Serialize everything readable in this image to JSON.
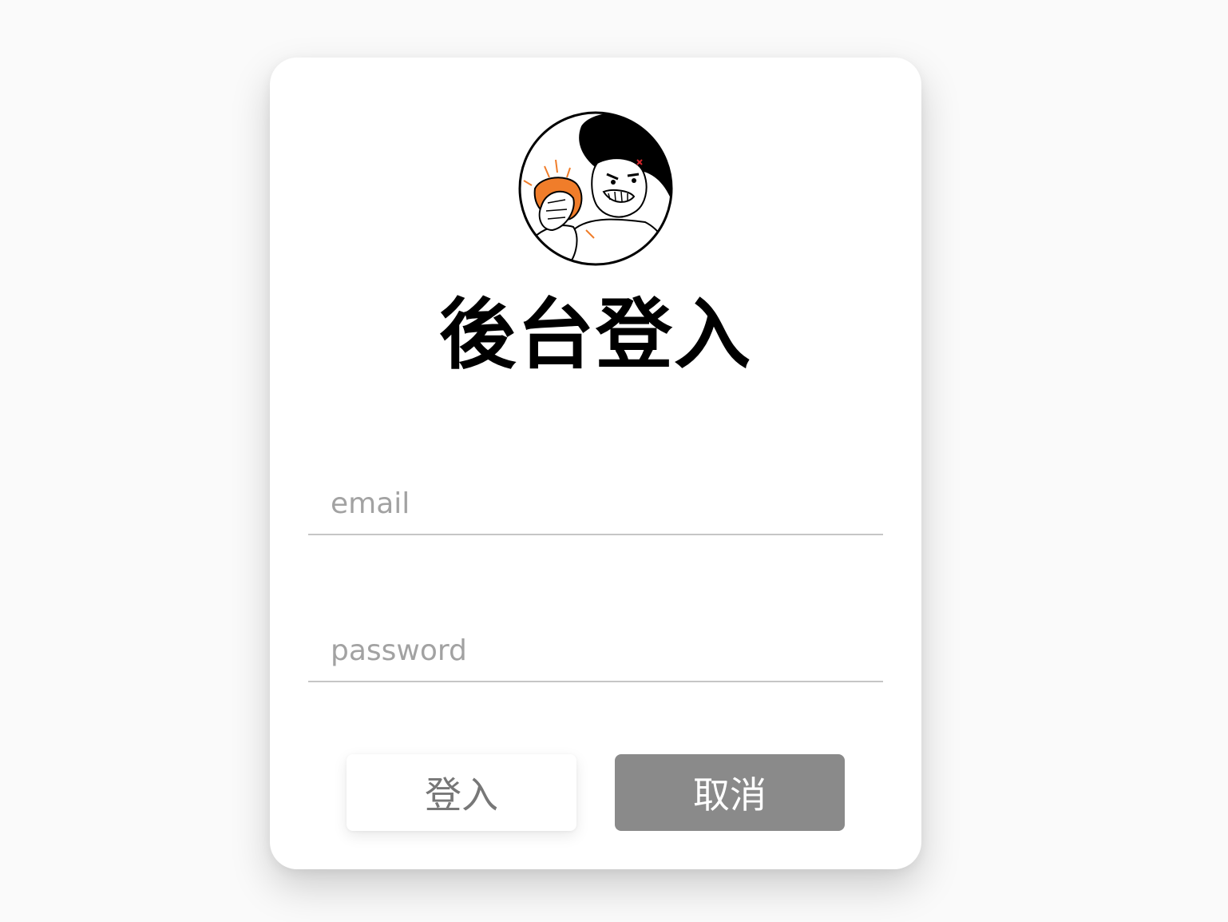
{
  "login": {
    "title": "後台登入",
    "avatar_icon": "cartoon-avatar-icon",
    "email": {
      "placeholder": "email",
      "value": ""
    },
    "password": {
      "placeholder": "password",
      "value": ""
    },
    "login_button_label": "登入",
    "cancel_button_label": "取消"
  },
  "colors": {
    "background": "#fafafa",
    "card": "#ffffff",
    "cancel_button": "#8a8a8a",
    "input_underline": "#c6c6c6",
    "placeholder": "#a2a2a2"
  }
}
